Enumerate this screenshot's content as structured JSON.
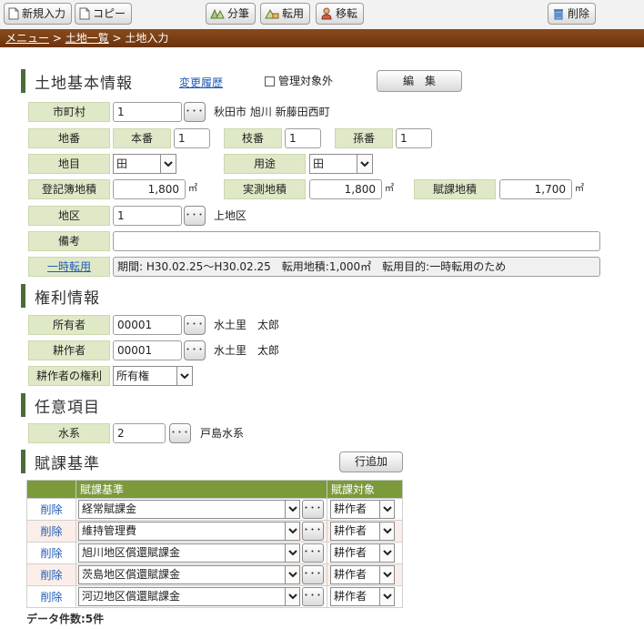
{
  "toolbar": {
    "new_label": "新規入力",
    "copy_label": "コピー",
    "split_label": "分筆",
    "convert_label": "転用",
    "transfer_label": "移転",
    "delete_label": "削除"
  },
  "breadcrumb": {
    "menu": "メニュー",
    "list": "土地一覧",
    "current": "土地入力",
    "sep": " > "
  },
  "basic": {
    "title": "土地基本情報",
    "history_link": "変更履歴",
    "manage_exclude_label": "管理対象外",
    "edit_button": "編　集",
    "city_label": "市町村",
    "city_value": "1",
    "city_name": "秋田市 旭川 新藤田西町",
    "lot_label": "地番",
    "honban_label": "本番",
    "honban_value": "1",
    "edaban_label": "枝番",
    "edaban_value": "1",
    "magoban_label": "孫番",
    "magoban_value": "1",
    "chimoku_label": "地目",
    "chimoku_value": "田",
    "youto_label": "用途",
    "youto_value": "田",
    "touki_label": "登記簿地積",
    "touki_value": "1,800",
    "jissoku_label": "実測地積",
    "jissoku_value": "1,800",
    "fuka_label": "賦課地積",
    "fuka_value": "1,700",
    "unit": "㎡",
    "district_label": "地区",
    "district_value": "1",
    "district_name": "上地区",
    "note_label": "備考",
    "note_value": "",
    "temp_label": "一時転用",
    "temp_value": "期間: H30.02.25～H30.02.25　転用地積:1,000㎡　転用目的:一時転用のため"
  },
  "rights": {
    "title": "権利情報",
    "owner_label": "所有者",
    "owner_value": "00001",
    "owner_name": "水土里　太郎",
    "cultivator_label": "耕作者",
    "cultivator_value": "00001",
    "cultivator_name": "水土里　太郎",
    "right_label": "耕作者の権利",
    "right_value": "所有権"
  },
  "optional": {
    "title": "任意項目",
    "water_label": "水系",
    "water_value": "2",
    "water_name": "戸島水系"
  },
  "levy": {
    "title": "賦課基準",
    "add_row_button": "行追加",
    "col_basis": "賦課基準",
    "col_target": "賦課対象",
    "delete_label": "削除",
    "rows": [
      {
        "basis": "経常賦課金",
        "target": "耕作者"
      },
      {
        "basis": "維持管理費",
        "target": "耕作者"
      },
      {
        "basis": "旭川地区償還賦課金",
        "target": "耕作者"
      },
      {
        "basis": "茨島地区償還賦課金",
        "target": "耕作者"
      },
      {
        "basis": "河辺地区償還賦課金",
        "target": "耕作者"
      }
    ],
    "count_text": "データ件数:5件"
  },
  "dots": "･･･",
  "colors": {
    "label_bg": "#dfe9c8",
    "header_green": "#7b9a3a",
    "breadcrumb_brown": "#7a3e15",
    "link": "#1e5ab4"
  }
}
